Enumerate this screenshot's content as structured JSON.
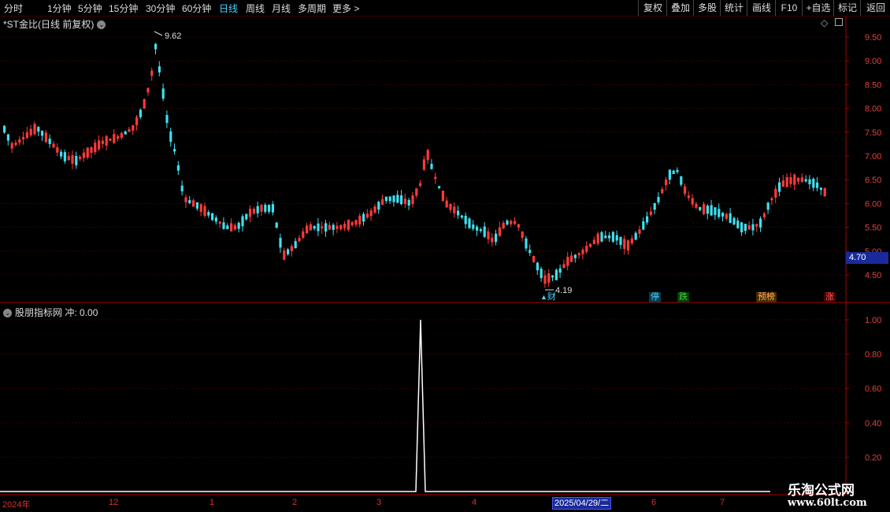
{
  "toolbar": {
    "periods": [
      "分时",
      "1分钟",
      "5分钟",
      "15分钟",
      "30分钟",
      "60分钟",
      "日线",
      "周线",
      "月线",
      "多周期",
      "更多"
    ],
    "active_period": "日线",
    "more_arrow": ">",
    "actions": [
      "复权",
      "叠加",
      "多股",
      "统计",
      "画线",
      "F10",
      "+自选",
      "返回"
    ]
  },
  "main_panel": {
    "title": "*ST金比(日线 前复权)",
    "price_axis": [
      "9.50",
      "9.00",
      "8.50",
      "8.00",
      "7.50",
      "7.00",
      "6.50",
      "6.00",
      "5.50",
      "5.00",
      "4.50"
    ],
    "current_price_tag": "4.70",
    "high_label": "9.62",
    "low_label": "4.19",
    "badges": [
      {
        "text": "财",
        "color": "#4fd0ff"
      },
      {
        "text": "停",
        "color": "#4fd0ff"
      },
      {
        "text": "跌",
        "color": "#3adc3a"
      },
      {
        "text": "预榜",
        "color": "#ff9a3a"
      },
      {
        "text": "涨",
        "color": "#ff5050"
      }
    ],
    "candle_colors": {
      "up": "#ff3a3a",
      "down": "#3fe0f0"
    }
  },
  "indicator_panel": {
    "title": "股朋指标网",
    "value_label": "冲: 0.00",
    "axis": [
      "1.00",
      "0.80",
      "0.60",
      "0.40",
      "0.20"
    ],
    "chart_data": {
      "type": "line",
      "series": [
        {
          "name": "冲",
          "values_note": "0 everywhere except a single spike",
          "peak_value": 1.0
        }
      ],
      "ylim": [
        0,
        1.0
      ]
    }
  },
  "date_axis": {
    "labels": [
      "2024年",
      "12",
      "1",
      "2",
      "3",
      "4",
      "6",
      "7"
    ],
    "cursor_date": "2025/04/29/二"
  },
  "watermark": {
    "name": "乐淘公式网",
    "url": "www.60lt.com"
  }
}
